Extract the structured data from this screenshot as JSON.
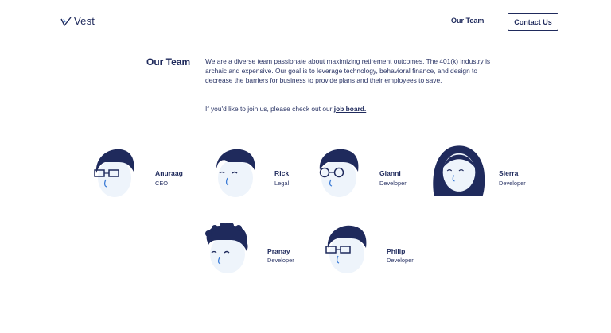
{
  "header": {
    "logo_text": "Vest",
    "nav_our_team": "Our Team",
    "contact_label": "Contact Us"
  },
  "intro": {
    "title": "Our Team",
    "description": "We are a diverse team passionate about maximizing retirement outcomes. The 401(k) industry is archaic and expensive. Our goal is to leverage technology, behavioral finance, and design to decrease the barriers for business to provide plans and their employees to save.",
    "join_prefix": "If you'd like to join us, please check out our ",
    "job_board_link": "job board."
  },
  "team": [
    {
      "name": "Anuraag",
      "role": "CEO",
      "avatar": "glasses-avatar-icon"
    },
    {
      "name": "Rick",
      "role": "Legal",
      "avatar": "smiling-avatar-icon"
    },
    {
      "name": "Gianni",
      "role": "Developer",
      "avatar": "round-glasses-avatar-icon"
    },
    {
      "name": "Sierra",
      "role": "Developer",
      "avatar": "long-hair-avatar-icon"
    },
    {
      "name": "Pranay",
      "role": "Developer",
      "avatar": "curly-hair-avatar-icon"
    },
    {
      "name": "Philip",
      "role": "Developer",
      "avatar": "glasses-avatar-icon"
    }
  ],
  "colors": {
    "navy": "#1f2a5c",
    "face": "#eef4fb",
    "accent": "#3b7bd6"
  }
}
